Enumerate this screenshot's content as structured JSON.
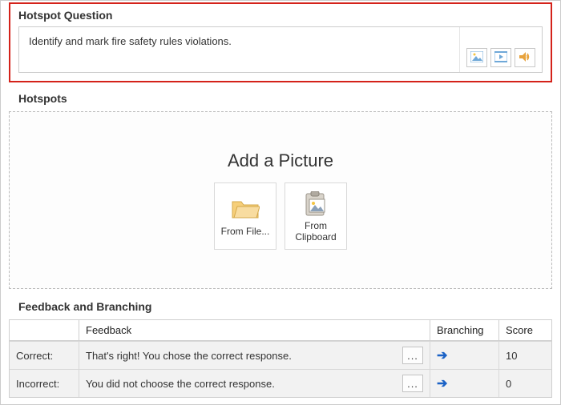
{
  "question": {
    "section_title": "Hotspot Question",
    "text": "Identify and mark fire safety rules violations.",
    "media_icons": {
      "image": "image-icon",
      "video": "video-icon",
      "audio": "audio-icon"
    }
  },
  "hotspots": {
    "section_title": "Hotspots",
    "add_title": "Add a Picture",
    "from_file_label": "From File...",
    "from_clipboard_label": "From\nClipboard"
  },
  "feedback": {
    "section_title": "Feedback and Branching",
    "headers": {
      "feedback": "Feedback",
      "branching": "Branching",
      "score": "Score"
    },
    "rows": [
      {
        "label": "Correct:",
        "text": "That's right! You chose the correct response.",
        "score": "10"
      },
      {
        "label": "Incorrect:",
        "text": "You did not choose the correct response.",
        "score": "0"
      }
    ],
    "ellipsis": "...",
    "arrow": "➔"
  }
}
